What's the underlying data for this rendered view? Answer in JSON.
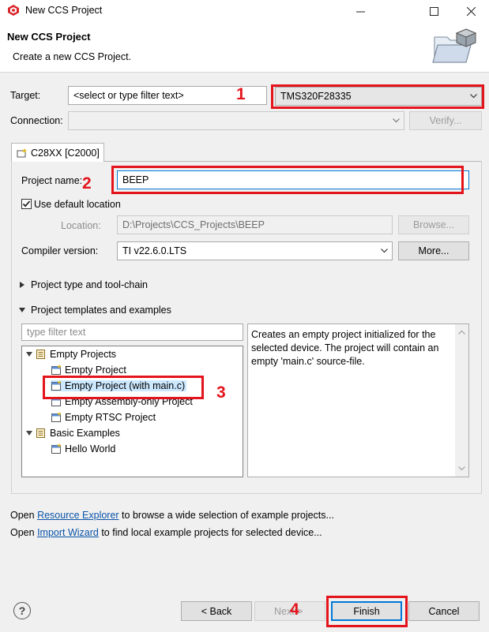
{
  "window": {
    "title": "New CCS Project"
  },
  "header": {
    "title": "New CCS Project",
    "subtitle": "Create a new CCS Project."
  },
  "target": {
    "label": "Target:",
    "filter_placeholder": "<select or type filter text>",
    "device": "TMS320F28335"
  },
  "connection": {
    "label": "Connection:",
    "verify_button": "Verify..."
  },
  "tab": {
    "label": "C28XX [C2000]"
  },
  "project": {
    "name_label": "Project name:",
    "name_value": "BEEP",
    "use_default_label": "Use default location",
    "use_default_checked": true,
    "location_label": "Location:",
    "location_value": "D:\\Projects\\CCS_Projects\\BEEP",
    "browse_button": "Browse...",
    "compiler_label": "Compiler version:",
    "compiler_value": "TI v22.6.0.LTS",
    "more_button": "More..."
  },
  "sections": {
    "toolchain": "Project type and tool-chain",
    "templates": "Project templates and examples"
  },
  "templates": {
    "filter_placeholder": "type filter text",
    "tree": {
      "empty_group": "Empty Projects",
      "empty_project": "Empty Project",
      "empty_project_main": "Empty Project (with main.c)",
      "empty_assembly": "Empty Assembly-only Project",
      "empty_rtsc": "Empty RTSC Project",
      "basic_group": "Basic Examples",
      "hello_world": "Hello World"
    },
    "description": "Creates an empty project initialized for the selected device. The project will contain an empty 'main.c' source-file."
  },
  "footer": {
    "line1_prefix": "Open ",
    "line1_link": "Resource Explorer",
    "line1_suffix": " to browse a wide selection of example projects...",
    "line2_prefix": "Open ",
    "line2_link": "Import Wizard",
    "line2_suffix": " to find local example projects for selected device..."
  },
  "buttons": {
    "help": "?",
    "back": "< Back",
    "next": "Next >",
    "finish": "Finish",
    "cancel": "Cancel"
  },
  "annotations": {
    "n1": "1",
    "n2": "2",
    "n3": "3",
    "n4": "4"
  },
  "colors": {
    "annotation_red": "#e3141b",
    "link_blue": "#0b54a8",
    "focus_blue": "#0078d7"
  }
}
